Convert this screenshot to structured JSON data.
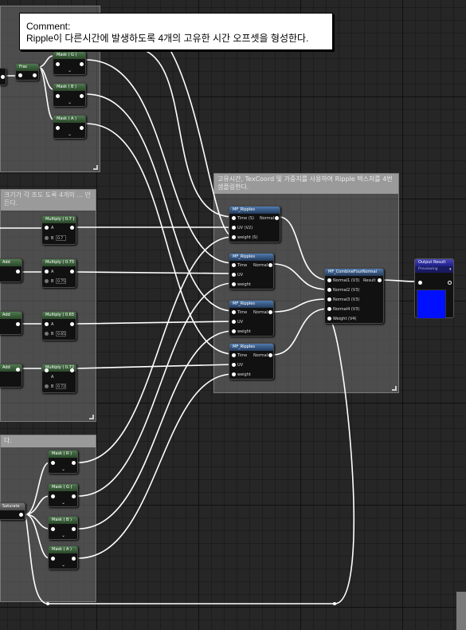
{
  "tooltip": {
    "title": "Comment:",
    "text": "Ripple이 다른시간에 발생하도록 4개의 고유한 시간 오프셋을 형성한다."
  },
  "comments": {
    "main_box_title": "고유시간, TexCoord 및 가중치를 사용하여 Ripple 텍스처를 4번 샘플링한다.",
    "left_mid_title": "크기가 각 조도 도록 4개의 ... 만든다.",
    "left_low_title": "다."
  },
  "nodes": {
    "frac": "Frac",
    "mask_g_top": "Mask ( G )",
    "mask_b_top": "Mask ( B )",
    "mask_a_top": "Mask ( A )",
    "multiply_1": "Multiply ( 0.7 )",
    "multiply_2": "Multiply ( 0.75 )",
    "multiply_3": "Multiply ( 0.65 )",
    "multiply_4": "Multiply ( 0.72 )",
    "add": "Add",
    "pin_a": "A",
    "pin_b": "B",
    "mult_vals": [
      "0.7",
      "0.75",
      "0.65",
      "0.72"
    ],
    "mask_r_low": "Mask ( R )",
    "mask_g_low": "Mask ( G )",
    "mask_b_low": "Mask ( B )",
    "mask_a_low": "Mask ( A )",
    "saturate": "Saturate"
  },
  "mf_ripples": {
    "title": "MF_Ripples",
    "first_inputs": [
      "Time (S)",
      "UV (V2)",
      "weight (S)"
    ],
    "inputs": [
      "Time",
      "UV",
      "weight"
    ],
    "output": "Normal"
  },
  "combine": {
    "title": "MF_CombineFourNormal",
    "inputs": [
      "Normal1 (V3)",
      "Normal2 (V3)",
      "Normal3 (V3)",
      "Normal4 (V3)",
      "Weight (V4)"
    ],
    "output": "Result"
  },
  "output_result": {
    "title": "Output Result",
    "status": "Previewing",
    "preview_color": "#0010ff"
  },
  "colors": {
    "background": "#262626",
    "wire": "#ffffff",
    "comment_header": "#9a9a9a"
  }
}
